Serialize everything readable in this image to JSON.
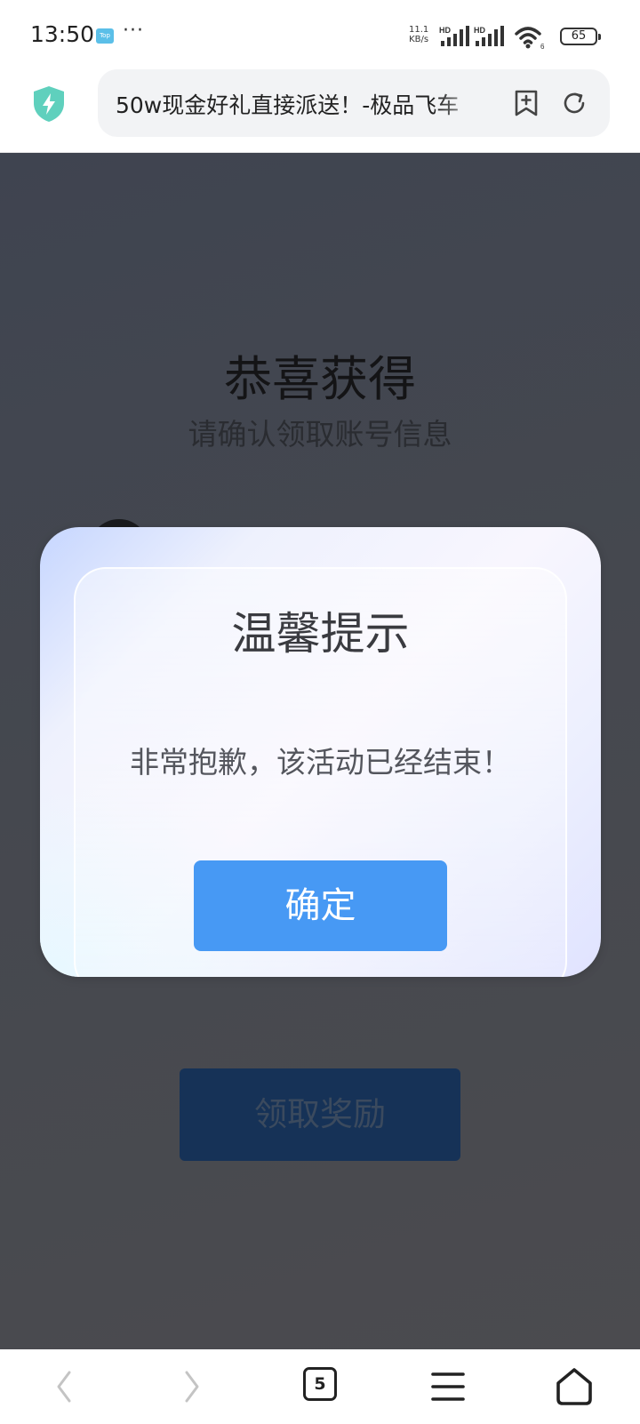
{
  "status_bar": {
    "time": "13:50",
    "app_icon_label": "Top",
    "more": "···",
    "net_speed_value": "11.1",
    "net_speed_unit": "KB/s",
    "signal1_label": "HD",
    "signal2_label": "HD",
    "wifi_index": "6",
    "battery": "65"
  },
  "address_bar": {
    "url_title": "50w现金好礼直接派送！-极品飞车",
    "shield_icon": "shield-bolt-icon",
    "bookmark_icon": "bookmark-add-icon",
    "refresh_icon": "refresh-icon"
  },
  "page": {
    "title": "恭喜获得",
    "subtitle": "请确认领取账号信息",
    "claim_button": "领取奖励"
  },
  "dialog": {
    "title": "温馨提示",
    "message": "非常抱歉，该活动已经结束！",
    "confirm": "确定"
  },
  "bottom_nav": {
    "tab_count": "5",
    "items": [
      "back-icon",
      "forward-icon",
      "tabs-icon",
      "menu-icon",
      "home-icon"
    ]
  },
  "colors": {
    "confirm_button": "#4799f4",
    "claim_button": "#163257",
    "overlay": "#46484f",
    "shield": "#5fd0bd"
  }
}
